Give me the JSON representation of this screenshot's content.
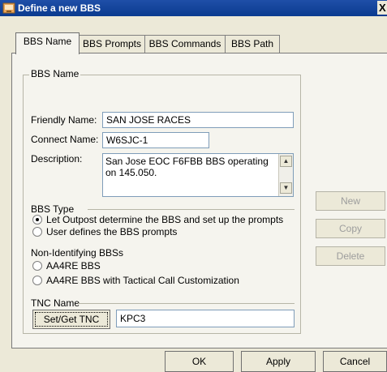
{
  "window": {
    "title": "Define a new BBS",
    "close_glyph": "X"
  },
  "tabs": [
    {
      "label": "BBS Name",
      "active": true
    },
    {
      "label": "BBS Prompts"
    },
    {
      "label": "BBS Commands"
    },
    {
      "label": "BBS Path"
    }
  ],
  "bbs_name_group": {
    "legend": "BBS Name",
    "friendly_name_label": "Friendly Name:",
    "friendly_name_value": "SAN JOSE RACES",
    "connect_name_label": "Connect Name:",
    "connect_name_value": "W6SJC-1",
    "description_label": "Description:",
    "description_value": "San Jose EOC F6FBB BBS operating on 145.050."
  },
  "bbs_type": {
    "legend": "BBS Type",
    "options": [
      {
        "label": "Let Outpost determine the BBS and set up the prompts",
        "checked": true
      },
      {
        "label": "User defines the BBS prompts",
        "checked": false
      }
    ]
  },
  "non_identifying": {
    "legend": "Non-Identifying BBSs",
    "options": [
      {
        "label": "AA4RE BBS",
        "checked": false
      },
      {
        "label": "AA4RE BBS with Tactical Call Customization",
        "checked": false
      }
    ]
  },
  "tnc_name": {
    "legend": "TNC Name",
    "button_label": "Set/Get TNC",
    "value": "KPC3"
  },
  "side_buttons": {
    "new": "New",
    "copy": "Copy",
    "delete": "Delete"
  },
  "footer_buttons": {
    "ok": "OK",
    "apply": "Apply",
    "cancel": "Cancel"
  },
  "colors": {
    "titlebar": "#0a3b8f",
    "dialog_bg": "#ece9d8",
    "panel_bg": "#f5f4ee",
    "field_border": "#7f9db9"
  }
}
